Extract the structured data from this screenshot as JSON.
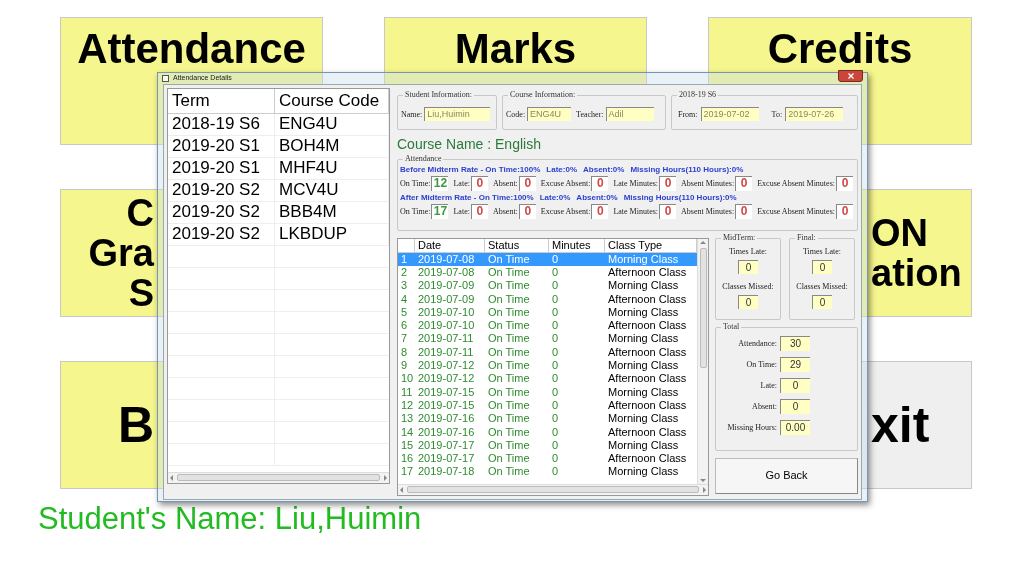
{
  "tile_rows": [
    [
      {
        "lines": [
          "Attendance"
        ],
        "color": "#f6f68e"
      },
      {
        "lines": [
          "Marks"
        ],
        "color": "#f6f68e"
      },
      {
        "lines": [
          "Credits"
        ],
        "color": "#f6f68e"
      }
    ],
    [
      {
        "lines": [
          "C",
          "Gra",
          "S"
        ],
        "color": "#f6f68e"
      },
      {},
      {
        "lines": [
          "ON",
          "ation"
        ],
        "color": "#f6f68e"
      }
    ],
    [
      {
        "lines": [
          "B"
        ],
        "color": "#f6f68e"
      },
      {},
      {
        "lines": [
          "xit"
        ],
        "color": "#efefef"
      }
    ]
  ],
  "dialog": {
    "title": "Attendance Details",
    "terms": {
      "columns": [
        "Term",
        "Course Code"
      ],
      "rows": [
        [
          "2018-19 S6",
          "ENG4U"
        ],
        [
          "2019-20 S1",
          "BOH4M"
        ],
        [
          "2019-20 S1",
          "MHF4U"
        ],
        [
          "2019-20 S2",
          "MCV4U"
        ],
        [
          "2019-20 S2",
          "BBB4M"
        ],
        [
          "2019-20 S2",
          "LKBDUP"
        ]
      ]
    },
    "student_info": {
      "legend": "Student Information:",
      "name_label": "Name:",
      "name": "Liu,Huimin"
    },
    "course_info": {
      "legend": "Course Information:",
      "code_label": "Code:",
      "code": "ENG4U",
      "teacher_label": "Teacher:",
      "teacher": "Adil"
    },
    "period": {
      "legend": "2018-19 S6",
      "from_label": "From:",
      "from": "2019-07-02",
      "to_label": "To:",
      "to": "2019-07-26"
    },
    "course_name": "Course Name : English",
    "attendance": {
      "legend": "Attendance",
      "sections": [
        {
          "summary": [
            "Before Midterm Rate - On Time:100%",
            "Late:0%",
            "Absent:0%",
            "Missing Hours(110 Hours):0%"
          ],
          "fields": [
            {
              "label": "On Time:",
              "value": "12",
              "color": "#3a9a3a"
            },
            {
              "label": "Late:",
              "value": "0",
              "color": "#d04848"
            },
            {
              "label": "Absent:",
              "value": "0",
              "color": "#d04848"
            },
            {
              "label": "Excuse Absent:",
              "value": "0",
              "color": "#d04848"
            },
            {
              "label": "Late Minutes:",
              "value": "0",
              "color": "#d04848"
            },
            {
              "label": "Absent Minutes:",
              "value": "0",
              "color": "#d04848"
            },
            {
              "label": "Excuse Absent Minutes:",
              "value": "0",
              "color": "#d04848"
            }
          ]
        },
        {
          "summary": [
            "After Midterm Rate - On Time:100%",
            "Late:0%",
            "Absent:0%",
            "Missing Hours(110 Hours):0%"
          ],
          "fields": [
            {
              "label": "On Time:",
              "value": "17",
              "color": "#3a9a3a"
            },
            {
              "label": "Late:",
              "value": "0",
              "color": "#d04848"
            },
            {
              "label": "Absent:",
              "value": "0",
              "color": "#d04848"
            },
            {
              "label": "Excuse Absent:",
              "value": "0",
              "color": "#d04848"
            },
            {
              "label": "Late Minutes:",
              "value": "0",
              "color": "#d04848"
            },
            {
              "label": "Absent Minutes:",
              "value": "0",
              "color": "#d04848"
            },
            {
              "label": "Excuse Absent Minutes:",
              "value": "0",
              "color": "#d04848"
            }
          ]
        }
      ]
    },
    "records": {
      "columns": [
        "Date",
        "Status",
        "Minutes",
        "Class Type"
      ],
      "rows": [
        {
          "no": "1",
          "date": "2019-07-08",
          "status": "On Time",
          "minutes": "0",
          "class_type": "Morning Class",
          "selected": true
        },
        {
          "no": "2",
          "date": "2019-07-08",
          "status": "On Time",
          "minutes": "0",
          "class_type": "Afternoon Class",
          "selected": false
        },
        {
          "no": "3",
          "date": "2019-07-09",
          "status": "On Time",
          "minutes": "0",
          "class_type": "Morning Class",
          "selected": false
        },
        {
          "no": "4",
          "date": "2019-07-09",
          "status": "On Time",
          "minutes": "0",
          "class_type": "Afternoon Class",
          "selected": false
        },
        {
          "no": "5",
          "date": "2019-07-10",
          "status": "On Time",
          "minutes": "0",
          "class_type": "Morning Class",
          "selected": false
        },
        {
          "no": "6",
          "date": "2019-07-10",
          "status": "On Time",
          "minutes": "0",
          "class_type": "Afternoon Class",
          "selected": false
        },
        {
          "no": "7",
          "date": "2019-07-11",
          "status": "On Time",
          "minutes": "0",
          "class_type": "Morning Class",
          "selected": false
        },
        {
          "no": "8",
          "date": "2019-07-11",
          "status": "On Time",
          "minutes": "0",
          "class_type": "Afternoon Class",
          "selected": false
        },
        {
          "no": "9",
          "date": "2019-07-12",
          "status": "On Time",
          "minutes": "0",
          "class_type": "Morning Class",
          "selected": false
        },
        {
          "no": "10",
          "date": "2019-07-12",
          "status": "On Time",
          "minutes": "0",
          "class_type": "Afternoon Class",
          "selected": false
        },
        {
          "no": "11",
          "date": "2019-07-15",
          "status": "On Time",
          "minutes": "0",
          "class_type": "Morning Class",
          "selected": false
        },
        {
          "no": "12",
          "date": "2019-07-15",
          "status": "On Time",
          "minutes": "0",
          "class_type": "Afternoon Class",
          "selected": false
        },
        {
          "no": "13",
          "date": "2019-07-16",
          "status": "On Time",
          "minutes": "0",
          "class_type": "Morning Class",
          "selected": false
        },
        {
          "no": "14",
          "date": "2019-07-16",
          "status": "On Time",
          "minutes": "0",
          "class_type": "Afternoon Class",
          "selected": false
        },
        {
          "no": "15",
          "date": "2019-07-17",
          "status": "On Time",
          "minutes": "0",
          "class_type": "Morning Class",
          "selected": false
        },
        {
          "no": "16",
          "date": "2019-07-17",
          "status": "On Time",
          "minutes": "0",
          "class_type": "Afternoon Class",
          "selected": false
        },
        {
          "no": "17",
          "date": "2019-07-18",
          "status": "On Time",
          "minutes": "0",
          "class_type": "Morning Class",
          "selected": false
        }
      ]
    },
    "midterm": {
      "legend": "MidTerm:",
      "times_late_label": "Times Late:",
      "times_late": "0",
      "classes_missed_label": "Classes Missed:",
      "classes_missed": "0"
    },
    "final": {
      "legend": "Final:",
      "times_late_label": "Times Late:",
      "times_late": "0",
      "classes_missed_label": "Classes Missed:",
      "classes_missed": "0"
    },
    "total": {
      "legend": "Total",
      "fields": [
        {
          "label": "Attendance:",
          "value": "30"
        },
        {
          "label": "On Time:",
          "value": "29"
        },
        {
          "label": "Late:",
          "value": "0"
        },
        {
          "label": "Absent:",
          "value": "0"
        },
        {
          "label": "Missing Hours:",
          "value": "0.00"
        }
      ]
    },
    "button": "Go Back"
  },
  "student_name": "Student's Name: Liu,Huimin"
}
